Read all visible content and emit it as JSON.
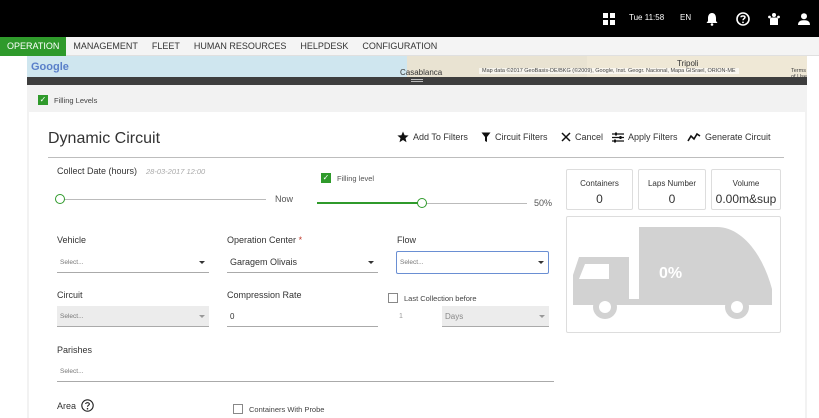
{
  "topbar": {
    "time": "Tue 11:58",
    "lang": "EN",
    "icons": [
      "widgets-icon",
      "bell-icon",
      "help-icon",
      "people-icon",
      "user-icon"
    ]
  },
  "nav": {
    "items": [
      "OPERATION",
      "MANAGEMENT",
      "FLEET",
      "HUMAN RESOURCES",
      "HELPDESK",
      "CONFIGURATION"
    ],
    "active_index": 0
  },
  "map": {
    "logo": "Google",
    "city1": "Casablanca",
    "city2": "Tripoli",
    "attribution": "Map data ©2017 GeoBasis-DE/BKG (©2009), Google, Inst. Geogr. Nacional, Mapa GISrael, ORION-ME",
    "terms": "Terms of Use"
  },
  "filling_levels_label": "Filling Levels",
  "panel": {
    "title": "Dynamic Circuit",
    "toolbar": {
      "add_to_filters": "Add To Filters",
      "circuit_filters": "Circuit Filters",
      "cancel": "Cancel",
      "apply_filters": "Apply Filters",
      "generate_circuit": "Generate Circuit"
    },
    "collect_date": {
      "label": "Collect Date (hours)",
      "value": "28-03-2017 12:00",
      "slider_end_label": "Now"
    },
    "filling_level": {
      "label": "Filling level",
      "checked": true,
      "value_label": "50%",
      "value": 0.5
    },
    "vehicle": {
      "label": "Vehicle",
      "placeholder": "Select..."
    },
    "operation_center": {
      "label": "Operation Center",
      "required_mark": "*",
      "value": "Garagem Olivais"
    },
    "flow": {
      "label": "Flow",
      "placeholder": "Select..."
    },
    "circuit": {
      "label": "Circuit",
      "placeholder": "Select..."
    },
    "compression_rate": {
      "label": "Compression Rate",
      "value": "0"
    },
    "last_collection": {
      "label": "Last Collection before",
      "number": "1",
      "unit": "Days"
    },
    "parishes": {
      "label": "Parishes",
      "placeholder": "Select..."
    },
    "area": {
      "label": "Area"
    },
    "containers_with_probe": {
      "label": "Containers With Probe"
    }
  },
  "stats": {
    "containers": {
      "label": "Containers",
      "value": "0"
    },
    "laps": {
      "label": "Laps Number",
      "value": "0"
    },
    "volume": {
      "label": "Volume",
      "value": "0.00m&sup"
    }
  },
  "truck": {
    "percent": "0%"
  },
  "colors": {
    "brand_green": "#2f9a2b",
    "topbar": "#000000",
    "truck_gray": "#d2d2d2"
  }
}
